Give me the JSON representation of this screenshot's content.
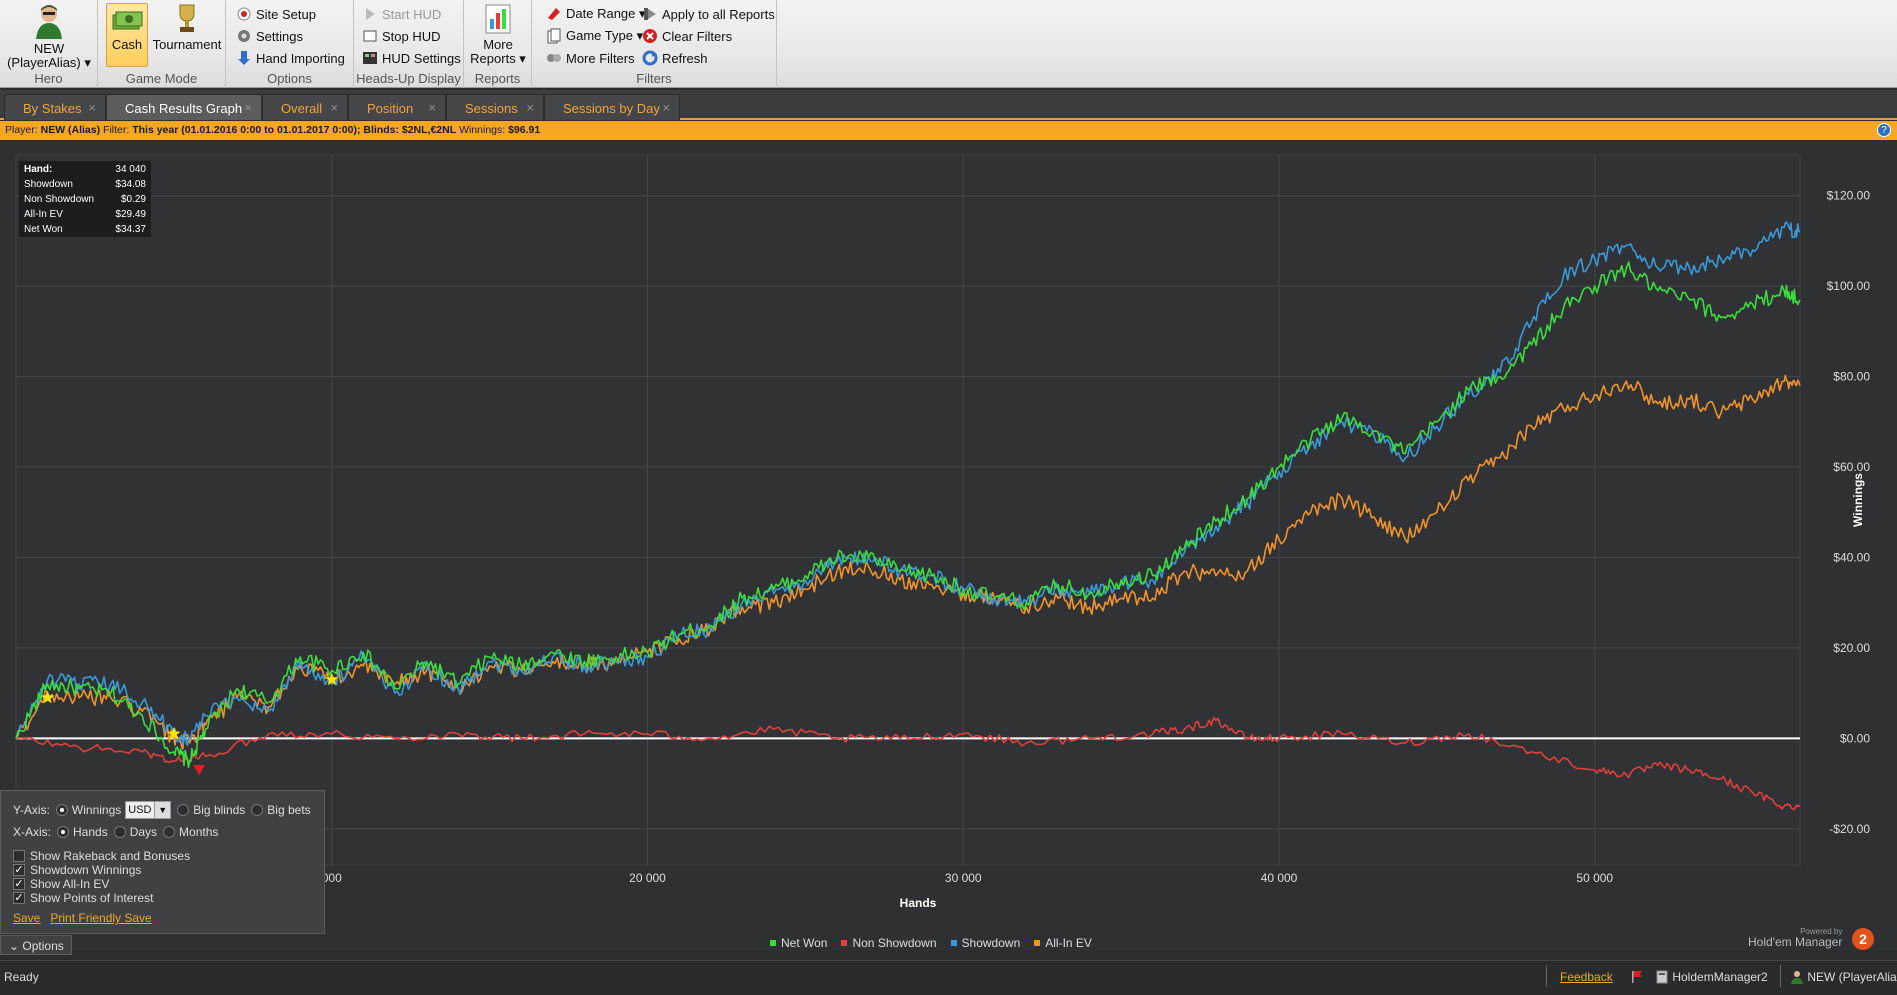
{
  "ribbon": {
    "hero": {
      "name_line1": "NEW",
      "name_line2": "(PlayerAlias) ▾",
      "group_label": "Hero"
    },
    "game_mode": {
      "cash_label": "Cash",
      "tournament_label": "Tournament",
      "group_label": "Game Mode"
    },
    "options": {
      "site_setup": "Site Setup",
      "settings": "Settings",
      "hand_importing": "Hand Importing",
      "group_label": "Options"
    },
    "hud": {
      "start_hud": "Start HUD",
      "stop_hud": "Stop HUD",
      "hud_settings": "HUD Settings",
      "group_label": "Heads-Up Display"
    },
    "reports": {
      "more_reports_line1": "More",
      "more_reports_line2": "Reports ▾",
      "group_label": "Reports"
    },
    "filters": {
      "date_range": "Date Range ▾",
      "game_type": "Game Type ▾",
      "more_filters": "More Filters",
      "apply_all": "Apply to all Reports",
      "clear_filters": "Clear Filters",
      "refresh": "Refresh",
      "group_label": "Filters"
    }
  },
  "tabs": [
    {
      "label": "By Stakes",
      "active": false
    },
    {
      "label": "Cash Results Graph",
      "active": true
    },
    {
      "label": "Overall",
      "active": false
    },
    {
      "label": "Position",
      "active": false
    },
    {
      "label": "Sessions",
      "active": false
    },
    {
      "label": "Sessions by Day",
      "active": false
    }
  ],
  "tab_close": "×",
  "filter_bar": {
    "player_label": "Player:",
    "player_value": "NEW (Alias)",
    "filter_label": "Filter:",
    "filter_value": "This year (01.01.2016 0:00 to 01.01.2017 0:00); Blinds: $2NL,€2NL",
    "winnings_label": "Winnings:",
    "winnings_value": "$96.91",
    "help": "?"
  },
  "stats": [
    {
      "label": "Hand:",
      "value": "34 040"
    },
    {
      "label": "Showdown",
      "value": "$34.08"
    },
    {
      "label": "Non Showdown",
      "value": "$0.29"
    },
    {
      "label": "All-In EV",
      "value": "$29.49"
    },
    {
      "label": "Net Won",
      "value": "$34.37"
    }
  ],
  "options_panel": {
    "yaxis_label": "Y-Axis:",
    "yaxis_options": [
      "Winnings",
      "Big blinds",
      "Big bets"
    ],
    "yaxis_selected": "Winnings",
    "currency": "USD",
    "xaxis_label": "X-Axis:",
    "xaxis_options": [
      "Hands",
      "Days",
      "Months"
    ],
    "xaxis_selected": "Hands",
    "checkboxes": [
      {
        "label": "Show Rakeback and Bonuses",
        "checked": false
      },
      {
        "label": "Showdown Winnings",
        "checked": true
      },
      {
        "label": "Show All-In EV",
        "checked": true
      },
      {
        "label": "Show Points of Interest",
        "checked": true
      }
    ],
    "save_link": "Save",
    "print_link": "Print Friendly Save",
    "toggle_label": "Options"
  },
  "branding": {
    "powered": "Powered by",
    "name": "Hold'em Manager",
    "logo": "2"
  },
  "statusbar": {
    "status": "Ready",
    "feedback": "Feedback",
    "db_name": "HoldemManager2",
    "player": "NEW (PlayerAlia"
  },
  "chart_data": {
    "type": "line",
    "xlabel": "Hands",
    "ylabel": "Winnings",
    "xlim": [
      0,
      56500
    ],
    "ylim": [
      -28,
      129
    ],
    "x_ticks": [
      10000,
      20000,
      30000,
      40000,
      50000
    ],
    "x_tick_labels": [
      "000",
      "20 000",
      "30 000",
      "40 000",
      "50 000"
    ],
    "y_ticks": [
      120,
      100,
      80,
      60,
      40,
      20,
      0,
      -20
    ],
    "y_tick_labels": [
      "$120.00",
      "$100.00",
      "$80.00",
      "$60.00",
      "$40.00",
      "$20.00",
      "$0.00",
      "-$20.00"
    ],
    "grid": true,
    "legend_position": "bottom-center",
    "series": [
      {
        "name": "Net Won",
        "color": "#3ddc3d",
        "x": [
          0,
          1000,
          2000,
          3000,
          4000,
          5000,
          5500,
          6000,
          7000,
          8000,
          9000,
          10000,
          11000,
          12000,
          13000,
          14000,
          15000,
          16000,
          17000,
          18000,
          19000,
          20000,
          21000,
          22000,
          23000,
          24000,
          25000,
          26000,
          27000,
          28000,
          29000,
          30000,
          31000,
          32000,
          33000,
          34000,
          35000,
          36000,
          37000,
          38000,
          39000,
          40000,
          41000,
          42000,
          43000,
          44000,
          45000,
          46000,
          47000,
          48000,
          49000,
          50000,
          51000,
          52000,
          53000,
          54000,
          55000,
          56000,
          56500
        ],
        "y": [
          0,
          12,
          11,
          10,
          5,
          -3,
          -5,
          2,
          11,
          8,
          18,
          15,
          19,
          11,
          17,
          12,
          18,
          16,
          19,
          17,
          18,
          19,
          23,
          25,
          31,
          33,
          36,
          40,
          40,
          37,
          36,
          33,
          31,
          30,
          34,
          32,
          35,
          36,
          42,
          48,
          53,
          60,
          66,
          71,
          68,
          63,
          70,
          77,
          80,
          87,
          95,
          100,
          104,
          99,
          97,
          93,
          96,
          99,
          97
        ]
      },
      {
        "name": "Non Showdown",
        "color": "#e0403a",
        "x": [
          0,
          2000,
          4000,
          5000,
          6000,
          8000,
          10000,
          12000,
          14000,
          16000,
          18000,
          20000,
          22000,
          24000,
          26000,
          28000,
          30000,
          32000,
          34000,
          36000,
          37000,
          38000,
          39000,
          40000,
          42000,
          44000,
          46000,
          48000,
          50000,
          51000,
          52000,
          53000,
          54000,
          55000,
          56000,
          56500
        ],
        "y": [
          0,
          -2,
          -3,
          -5,
          -4,
          1,
          1,
          0,
          1,
          0,
          1,
          1,
          0,
          2,
          0,
          0,
          1,
          -1,
          0,
          1,
          2,
          4,
          0,
          0,
          1,
          -1,
          1,
          -3,
          -7,
          -8,
          -6,
          -7,
          -9,
          -12,
          -15,
          -15
        ]
      },
      {
        "name": "Showdown",
        "color": "#3a9ad9",
        "x": [
          0,
          1000,
          2000,
          3000,
          4000,
          5000,
          5500,
          6000,
          7000,
          8000,
          9000,
          10000,
          11000,
          12000,
          13000,
          14000,
          15000,
          16000,
          17000,
          18000,
          19000,
          20000,
          21000,
          22000,
          23000,
          24000,
          25000,
          26000,
          27000,
          28000,
          29000,
          30000,
          31000,
          32000,
          33000,
          34000,
          35000,
          36000,
          37000,
          38000,
          39000,
          40000,
          41000,
          42000,
          43000,
          44000,
          45000,
          46000,
          47000,
          48000,
          49000,
          50000,
          51000,
          52000,
          53000,
          54000,
          55000,
          56000,
          56500
        ],
        "y": [
          0,
          13,
          12,
          12,
          8,
          1,
          0,
          5,
          9,
          6,
          17,
          12,
          18,
          10,
          16,
          11,
          17,
          15,
          18,
          16,
          17,
          18,
          23,
          24,
          30,
          32,
          35,
          39,
          40,
          37,
          36,
          33,
          31,
          30,
          33,
          32,
          34,
          35,
          41,
          47,
          52,
          59,
          65,
          70,
          67,
          62,
          69,
          76,
          81,
          92,
          102,
          106,
          109,
          104,
          104,
          106,
          108,
          113,
          112
        ]
      },
      {
        "name": "All-In EV",
        "color": "#f0932b",
        "x": [
          0,
          1000,
          2000,
          3000,
          4000,
          5000,
          5500,
          6000,
          7000,
          8000,
          9000,
          10000,
          11000,
          12000,
          13000,
          14000,
          15000,
          16000,
          17000,
          18000,
          19000,
          20000,
          21000,
          22000,
          23000,
          24000,
          25000,
          26000,
          27000,
          28000,
          29000,
          30000,
          31000,
          32000,
          33000,
          34000,
          35000,
          36000,
          37000,
          38000,
          39000,
          40000,
          41000,
          42000,
          43000,
          44000,
          45000,
          46000,
          47000,
          48000,
          49000,
          50000,
          51000,
          52000,
          53000,
          54000,
          55000,
          56000,
          56500
        ],
        "y": [
          0,
          10,
          9,
          9,
          6,
          0,
          -1,
          3,
          9,
          7,
          16,
          13,
          16,
          12,
          15,
          11,
          16,
          15,
          17,
          16,
          17,
          19,
          22,
          24,
          29,
          30,
          33,
          37,
          38,
          35,
          34,
          32,
          31,
          29,
          31,
          29,
          31,
          31,
          37,
          36,
          37,
          44,
          50,
          53,
          49,
          44,
          50,
          57,
          62,
          69,
          73,
          76,
          79,
          74,
          75,
          72,
          75,
          79,
          78
        ]
      }
    ],
    "points_of_interest": [
      {
        "type": "star",
        "x": 1000,
        "y": 9,
        "color": "#f5e50a"
      },
      {
        "type": "star",
        "x": 5000,
        "y": 1,
        "color": "#f5e50a"
      },
      {
        "type": "star",
        "x": 10000,
        "y": 13,
        "color": "#f5e50a"
      },
      {
        "type": "down-triangle",
        "x": 5800,
        "y": -7,
        "color": "#e02020"
      }
    ]
  }
}
